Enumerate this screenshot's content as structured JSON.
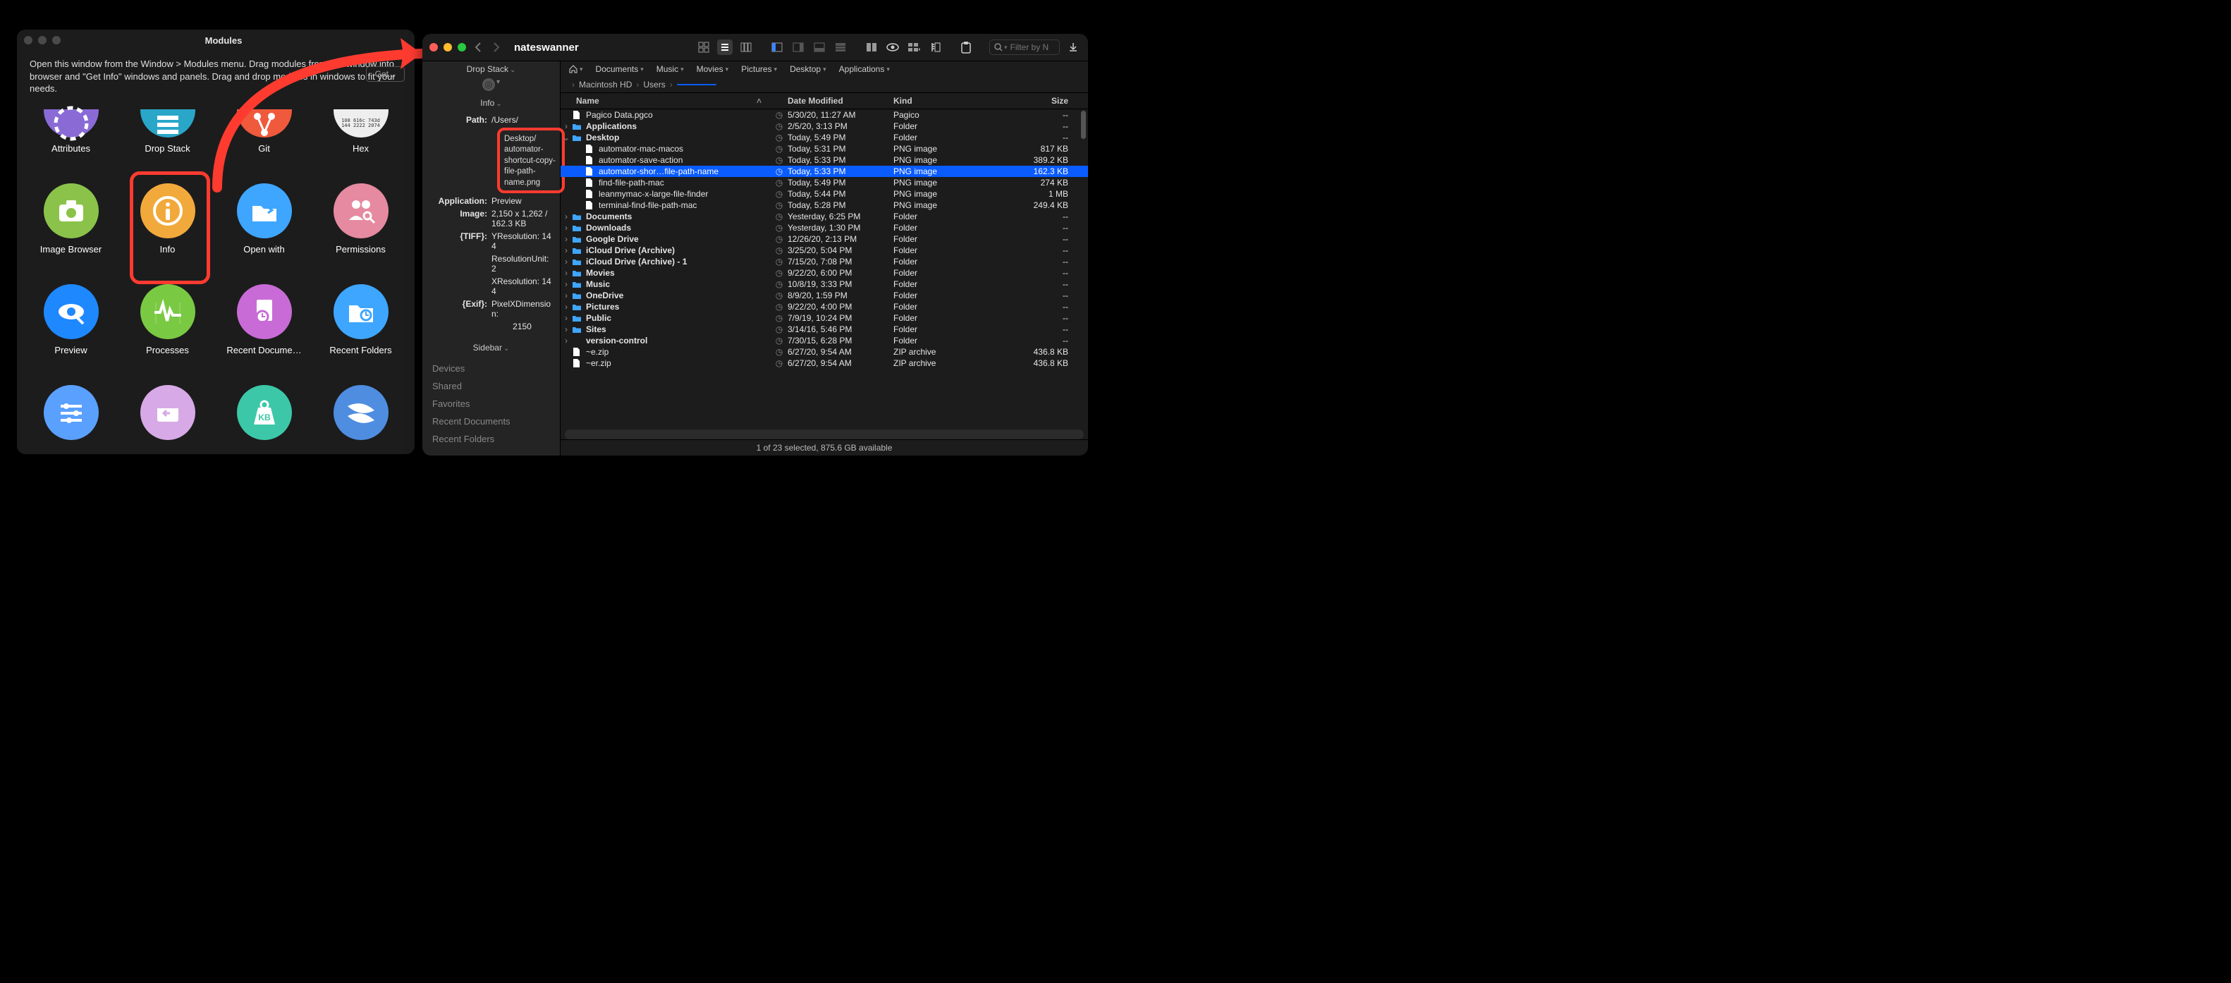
{
  "modules": {
    "title": "Modules",
    "instructions": "Open this window from the Window > Modules menu. Drag modules from this window into browser and \"Get Info\" windows and panels. Drag and drop modules in windows to fit your needs.",
    "get_button": "Get...",
    "items": [
      {
        "label": "Attributes",
        "iconName": "attributes-icon"
      },
      {
        "label": "Drop Stack",
        "iconName": "drop-stack-icon"
      },
      {
        "label": "Git",
        "iconName": "git-icon"
      },
      {
        "label": "Hex",
        "iconName": "hex-icon"
      },
      {
        "label": "Image Browser",
        "iconName": "camera-icon"
      },
      {
        "label": "Info",
        "iconName": "info-icon"
      },
      {
        "label": "Open with",
        "iconName": "folder-open-icon"
      },
      {
        "label": "Permissions",
        "iconName": "people-key-icon"
      },
      {
        "label": "Preview",
        "iconName": "eye-icon"
      },
      {
        "label": "Processes",
        "iconName": "activity-icon"
      },
      {
        "label": "Recent Docume…",
        "iconName": "recent-doc-icon"
      },
      {
        "label": "Recent Folders",
        "iconName": "recent-folder-icon"
      },
      {
        "label": "",
        "iconName": "sliders-icon"
      },
      {
        "label": "",
        "iconName": "app-window-icon"
      },
      {
        "label": "",
        "iconName": "weight-icon"
      },
      {
        "label": "",
        "iconName": "spiral-icon"
      }
    ]
  },
  "finder": {
    "title": "nateswanner",
    "search_placeholder": "Filter by N",
    "favorites": [
      {
        "label": "Documents",
        "iconName": "documents-icon"
      },
      {
        "label": "Music",
        "iconName": "music-icon"
      },
      {
        "label": "Movies",
        "iconName": "movies-icon"
      },
      {
        "label": "Pictures",
        "iconName": "pictures-icon"
      },
      {
        "label": "Desktop",
        "iconName": "desktop-icon"
      },
      {
        "label": "Applications",
        "iconName": "applications-icon"
      }
    ],
    "breadcrumb": {
      "apple": "",
      "segments": [
        "Macintosh HD",
        "Users"
      ],
      "current_masked": " "
    },
    "columns": {
      "name": "Name",
      "modified": "Date Modified",
      "kind": "Kind",
      "size": "Size"
    },
    "left": {
      "drop_stack": "Drop Stack",
      "info_hdr": "Info",
      "path_label": "Path:",
      "path_value": "/Users/",
      "path_box": "Desktop/\nautomator-\nshortcut-copy-\nfile-path-\nname.png",
      "app_label": "Application:",
      "app_value": "Preview",
      "image_label": "Image:",
      "image_value": "2,150 x 1,262 / 162.3 KB",
      "tiff_label": "{TIFF}:",
      "tiff_yres": "YResolution: 144",
      "tiff_unit": "ResolutionUnit: 2",
      "tiff_xres": "XResolution: 144",
      "exif_label": "{Exif}:",
      "exif_val": "PixelXDimension:",
      "exif_n": "2150",
      "sidebar_hdr": "Sidebar",
      "sidebar_items": [
        "Devices",
        "Shared",
        "Favorites",
        "Recent Documents",
        "Recent Folders"
      ]
    },
    "files": [
      {
        "indent": 0,
        "name": "Pagico Data.pgco",
        "bold": false,
        "disclosure": "",
        "icon": "doc",
        "date": "5/30/20, 11:27 AM",
        "kind": "Pagico",
        "size": "--"
      },
      {
        "indent": 0,
        "name": "Applications",
        "bold": true,
        "disclosure": ">",
        "icon": "folder",
        "date": "2/5/20, 3:13 PM",
        "kind": "Folder",
        "size": "--"
      },
      {
        "indent": 0,
        "name": "Desktop",
        "bold": true,
        "disclosure": "v",
        "icon": "folder",
        "date": "Today, 5:49 PM",
        "kind": "Folder",
        "size": "--"
      },
      {
        "indent": 1,
        "name": "automator-mac-macos",
        "bold": false,
        "disclosure": "",
        "icon": "doc",
        "date": "Today, 5:31 PM",
        "kind": "PNG image",
        "size": "817 KB"
      },
      {
        "indent": 1,
        "name": "automator-save-action",
        "bold": false,
        "disclosure": "",
        "icon": "doc",
        "date": "Today, 5:33 PM",
        "kind": "PNG image",
        "size": "389.2 KB"
      },
      {
        "indent": 1,
        "name": "automator-shor…file-path-name",
        "bold": false,
        "disclosure": "",
        "icon": "doc",
        "date": "Today, 5:33 PM",
        "kind": "PNG image",
        "size": "162.3 KB",
        "selected": true
      },
      {
        "indent": 1,
        "name": "find-file-path-mac",
        "bold": false,
        "disclosure": "",
        "icon": "doc",
        "date": "Today, 5:49 PM",
        "kind": "PNG image",
        "size": "274 KB"
      },
      {
        "indent": 1,
        "name": "leanmymac-x-large-file-finder",
        "bold": false,
        "disclosure": "",
        "icon": "doc",
        "date": "Today, 5:44 PM",
        "kind": "PNG image",
        "size": "1 MB"
      },
      {
        "indent": 1,
        "name": "terminal-find-file-path-mac",
        "bold": false,
        "disclosure": "",
        "icon": "doc",
        "date": "Today, 5:28 PM",
        "kind": "PNG image",
        "size": "249.4 KB"
      },
      {
        "indent": 0,
        "name": "Documents",
        "bold": true,
        "disclosure": ">",
        "icon": "folder",
        "date": "Yesterday, 6:25 PM",
        "kind": "Folder",
        "size": "--"
      },
      {
        "indent": 0,
        "name": "Downloads",
        "bold": true,
        "disclosure": ">",
        "icon": "folder",
        "date": "Yesterday, 1:30 PM",
        "kind": "Folder",
        "size": "--"
      },
      {
        "indent": 0,
        "name": "Google Drive",
        "bold": true,
        "disclosure": ">",
        "icon": "folder",
        "date": "12/26/20, 2:13 PM",
        "kind": "Folder",
        "size": "--"
      },
      {
        "indent": 0,
        "name": "iCloud Drive (Archive)",
        "bold": true,
        "disclosure": ">",
        "icon": "folder",
        "date": "3/25/20, 5:04 PM",
        "kind": "Folder",
        "size": "--"
      },
      {
        "indent": 0,
        "name": "iCloud Drive (Archive) - 1",
        "bold": true,
        "disclosure": ">",
        "icon": "folder",
        "date": "7/15/20, 7:08 PM",
        "kind": "Folder",
        "size": "--"
      },
      {
        "indent": 0,
        "name": "Movies",
        "bold": true,
        "disclosure": ">",
        "icon": "folder",
        "date": "9/22/20, 6:00 PM",
        "kind": "Folder",
        "size": "--"
      },
      {
        "indent": 0,
        "name": "Music",
        "bold": true,
        "disclosure": ">",
        "icon": "folder",
        "date": "10/8/19, 3:33 PM",
        "kind": "Folder",
        "size": "--"
      },
      {
        "indent": 0,
        "name": "OneDrive",
        "bold": true,
        "disclosure": ">",
        "icon": "folder",
        "date": "8/9/20, 1:59 PM",
        "kind": "Folder",
        "size": "--"
      },
      {
        "indent": 0,
        "name": "Pictures",
        "bold": true,
        "disclosure": ">",
        "icon": "folder",
        "date": "9/22/20, 4:00 PM",
        "kind": "Folder",
        "size": "--"
      },
      {
        "indent": 0,
        "name": "Public",
        "bold": true,
        "disclosure": ">",
        "icon": "folder",
        "date": "7/9/19, 10:24 PM",
        "kind": "Folder",
        "size": "--"
      },
      {
        "indent": 0,
        "name": "Sites",
        "bold": true,
        "disclosure": ">",
        "icon": "folder",
        "date": "3/14/16, 5:46 PM",
        "kind": "Folder",
        "size": "--"
      },
      {
        "indent": 0,
        "name": "version-control",
        "bold": true,
        "disclosure": ">",
        "icon": "none",
        "date": "7/30/15, 6:28 PM",
        "kind": "Folder",
        "size": "--"
      },
      {
        "indent": 0,
        "name": "~e.zip",
        "bold": false,
        "disclosure": "",
        "icon": "doc",
        "date": "6/27/20, 9:54 AM",
        "kind": "ZIP archive",
        "size": "436.8 KB"
      },
      {
        "indent": 0,
        "name": "~er.zip",
        "bold": false,
        "disclosure": "",
        "icon": "doc",
        "date": "6/27/20, 9:54 AM",
        "kind": "ZIP archive",
        "size": "436.8 KB"
      }
    ],
    "status": "1 of 23 selected, 875.6 GB available"
  }
}
